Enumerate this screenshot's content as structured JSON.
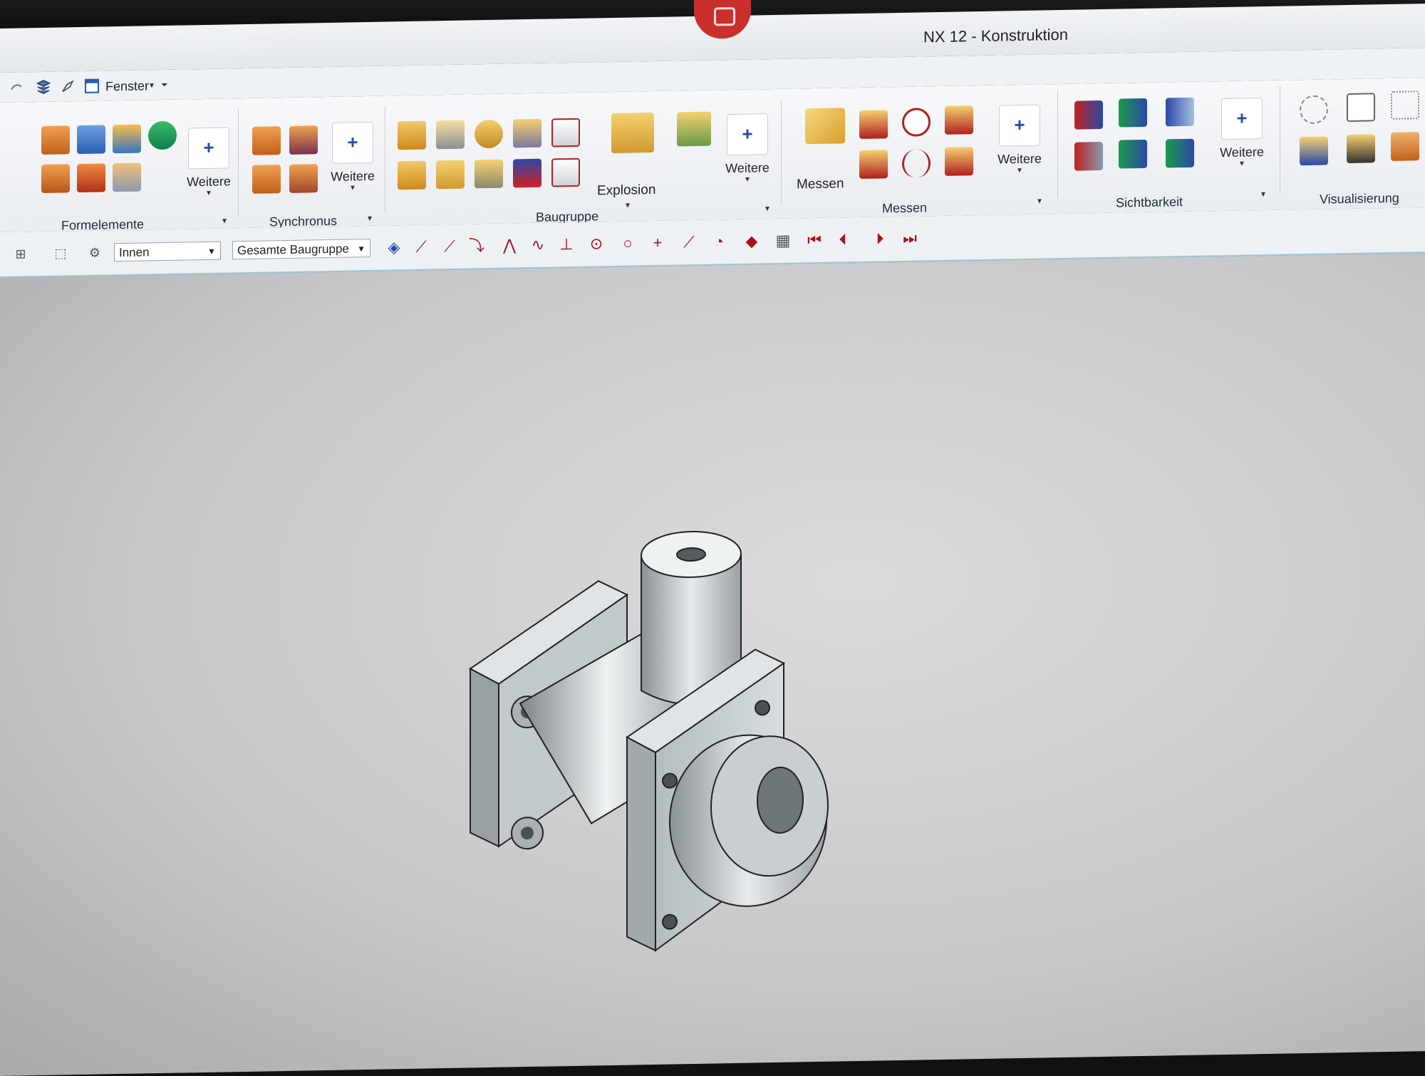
{
  "window": {
    "title": "NX 12 - Konstruktion"
  },
  "quick_access": {
    "menu_label": "Fenster"
  },
  "ribbon": {
    "groups": [
      {
        "label": "Formelemente",
        "more_label": "Weitere"
      },
      {
        "label": "Synchronus",
        "more_label": "Weitere"
      },
      {
        "label": "Baugruppe",
        "explosion_label": "Explosion",
        "more_label": "Weitere"
      },
      {
        "label": "Messen",
        "measure_label": "Messen",
        "more_label": "Weitere"
      },
      {
        "label": "Sichtbarkeit",
        "more_label": "Weitere"
      },
      {
        "label": "Visualisierung"
      }
    ]
  },
  "selection_bar": {
    "filter_value": "Innen",
    "scope_value": "Gesamte Baugruppe"
  },
  "colors": {
    "accent_plus": "#2a48a8",
    "snap_icons": "#a5131b",
    "viewport_bg": "#d4d4d6",
    "model_face": "#b9c0c4"
  }
}
